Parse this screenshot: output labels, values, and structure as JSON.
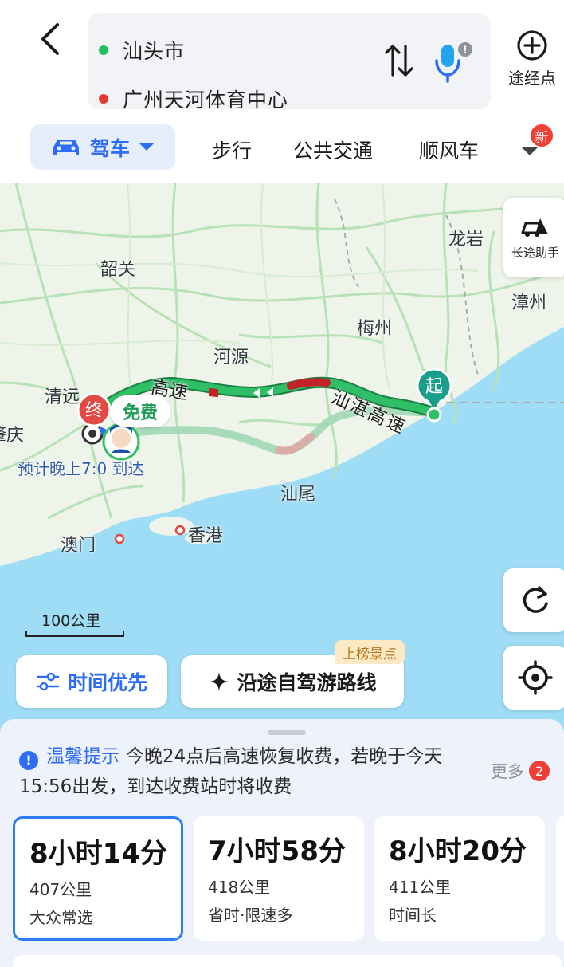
{
  "header": {
    "start": "汕头市",
    "end": "广州天河体育中心",
    "waypoint_label": "途经点"
  },
  "mode_tabs": {
    "drive": "驾车",
    "walk": "步行",
    "transit": "公共交通",
    "ride": "顺风车",
    "new_badge": "新"
  },
  "map": {
    "cities": {
      "shaoguan": "韶关",
      "longyan": "龙岩",
      "zhangzhou": "漳州",
      "meizhou": "梅州",
      "heyuan": "河源",
      "qingyuan": "清远",
      "zhaoqing": "肇庆",
      "shanwei": "汕尾",
      "macau": "澳门",
      "hongkong": "香港"
    },
    "road_label_1": "高速",
    "road_label_2": "汕湛高速",
    "start_marker": "起",
    "end_marker": "终",
    "free_label": "免费",
    "eta": "预计晚上7:0 到达",
    "long_trip_assistant": "长途助手",
    "scale": "100公里",
    "time_priority": "时间优先",
    "scenic_route": "沿途自驾游路线",
    "top_spot_badge": "上榜景点"
  },
  "notice": {
    "title": "温馨提示",
    "text": "今晚24点后高速恢复收费，若晚于今天15:56出发，到达收费站时将收费",
    "more_label": "更多",
    "more_count": "2"
  },
  "routes": [
    {
      "duration": "8小时14分",
      "distance": "407公里",
      "tag": "大众常选",
      "selected": true
    },
    {
      "duration": "7小时58分",
      "distance": "418公里",
      "tag": "省时·限速多",
      "selected": false
    },
    {
      "duration": "8小时20分",
      "distance": "411公里",
      "tag": "时间长",
      "selected": false
    }
  ],
  "colors": {
    "accent": "#2d6cf5",
    "start_dot": "#20c15f",
    "end_dot": "#e7372f",
    "route_main": "#22b35c",
    "route_alt": "#9ed8b5",
    "congestion": "#c0232a",
    "sea": "#9fdcf5",
    "land": "#eef4ea"
  }
}
